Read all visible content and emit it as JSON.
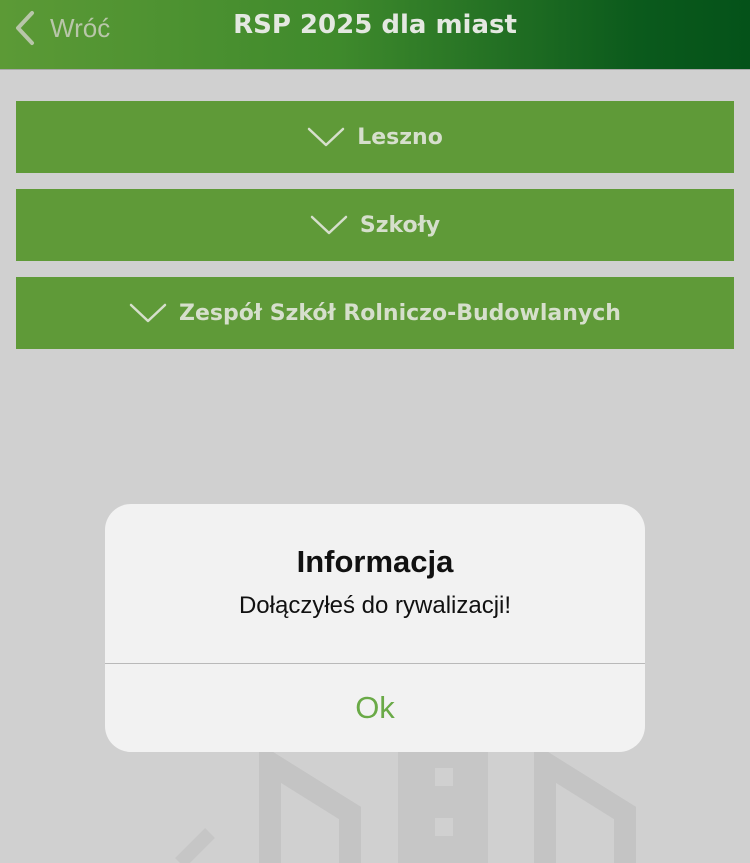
{
  "header": {
    "back_label": "Wróć",
    "title": "RSP 2025 dla miast"
  },
  "breadcrumbs": [
    {
      "label": "Leszno",
      "icon": "chevron-down-icon"
    },
    {
      "label": "Szkoły",
      "icon": "chevron-down-icon"
    },
    {
      "label": "Zespół Szkół Rolniczo-Budowlanych",
      "icon": "chevron-down-icon"
    }
  ],
  "dialog": {
    "title": "Informacja",
    "message": "Dołączyłeś do rywalizacji!",
    "ok_label": "Ok"
  },
  "colors": {
    "nav_gradient_start": "#5c9a36",
    "nav_gradient_end": "#045219",
    "crumb_bg": "#5f9a38",
    "dialog_button": "#6aaa47",
    "page_bg": "#d0d0d0"
  }
}
